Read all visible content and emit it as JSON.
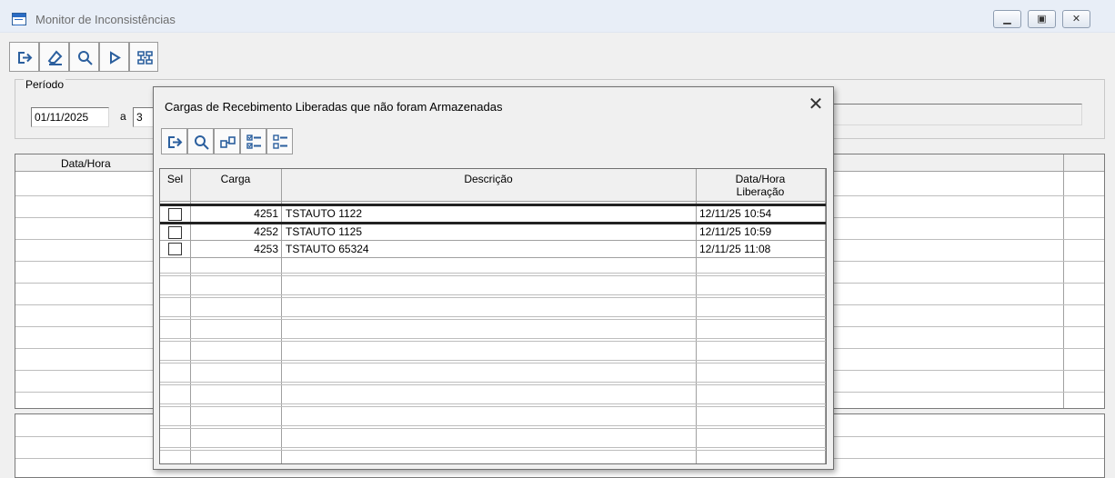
{
  "window": {
    "title": "Monitor de Inconsistências",
    "buttons": {
      "minimize": "▁",
      "maximize": "▣",
      "close": "✕"
    }
  },
  "toolbar": {
    "icons": [
      "exit-icon",
      "eraser-icon",
      "search-icon",
      "play-icon",
      "process-icon"
    ]
  },
  "period": {
    "label": "Período",
    "from": "01/11/2025",
    "separator": "a",
    "to_partial": "3"
  },
  "main_grid": {
    "columns": [
      "Data/Hora"
    ]
  },
  "dialog": {
    "title": "Cargas de Recebimento Liberadas que não foram Armazenadas",
    "close": "✕",
    "toolbar_icons": [
      "exit-icon",
      "search-icon",
      "binoculars-icon",
      "check-all-icon",
      "uncheck-all-icon"
    ],
    "columns": {
      "sel": "Sel",
      "carga": "Carga",
      "descricao": "Descrição",
      "data_hora": "Data/Hora",
      "liberacao": "Liberação"
    },
    "rows": [
      {
        "carga": "4251",
        "descricao": "TSTAUTO 1122",
        "data": "12/11/25 10:54",
        "checked": false
      },
      {
        "carga": "4252",
        "descricao": "TSTAUTO 1125",
        "data": "12/11/25 10:59",
        "checked": false
      },
      {
        "carga": "4253",
        "descricao": "TSTAUTO 65324",
        "data": "12/11/25 11:08",
        "checked": false
      }
    ]
  },
  "colors": {
    "accent": "#2b6cc4",
    "titlebar": "#e8eef7"
  }
}
